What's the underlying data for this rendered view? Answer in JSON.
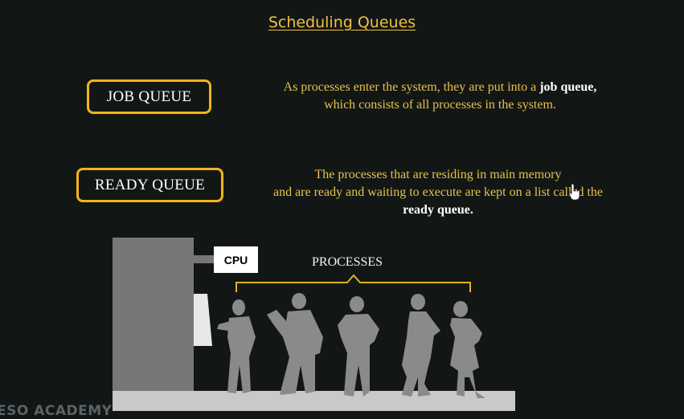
{
  "slide": {
    "title": "Scheduling Queues"
  },
  "job_queue": {
    "label": "JOB QUEUE",
    "desc_part1": "As processes enter the system, they are put into a ",
    "desc_bold": "job queue,",
    "desc_part2": "which consists of all processes in the system."
  },
  "ready_queue": {
    "label": "READY QUEUE",
    "desc_line1": "The processes that are residing in main memory",
    "desc_line2": "and are ready and waiting to execute are kept on a list called the",
    "desc_bold": "ready queue."
  },
  "diagram": {
    "cpu_label": "CPU",
    "processes_label": "PROCESSES"
  },
  "watermark": "ESO ACADEMY",
  "colors": {
    "background": "#121716",
    "accent": "#f2b417",
    "text": "#e9c24a",
    "silhouette": "#8a8a8a"
  }
}
